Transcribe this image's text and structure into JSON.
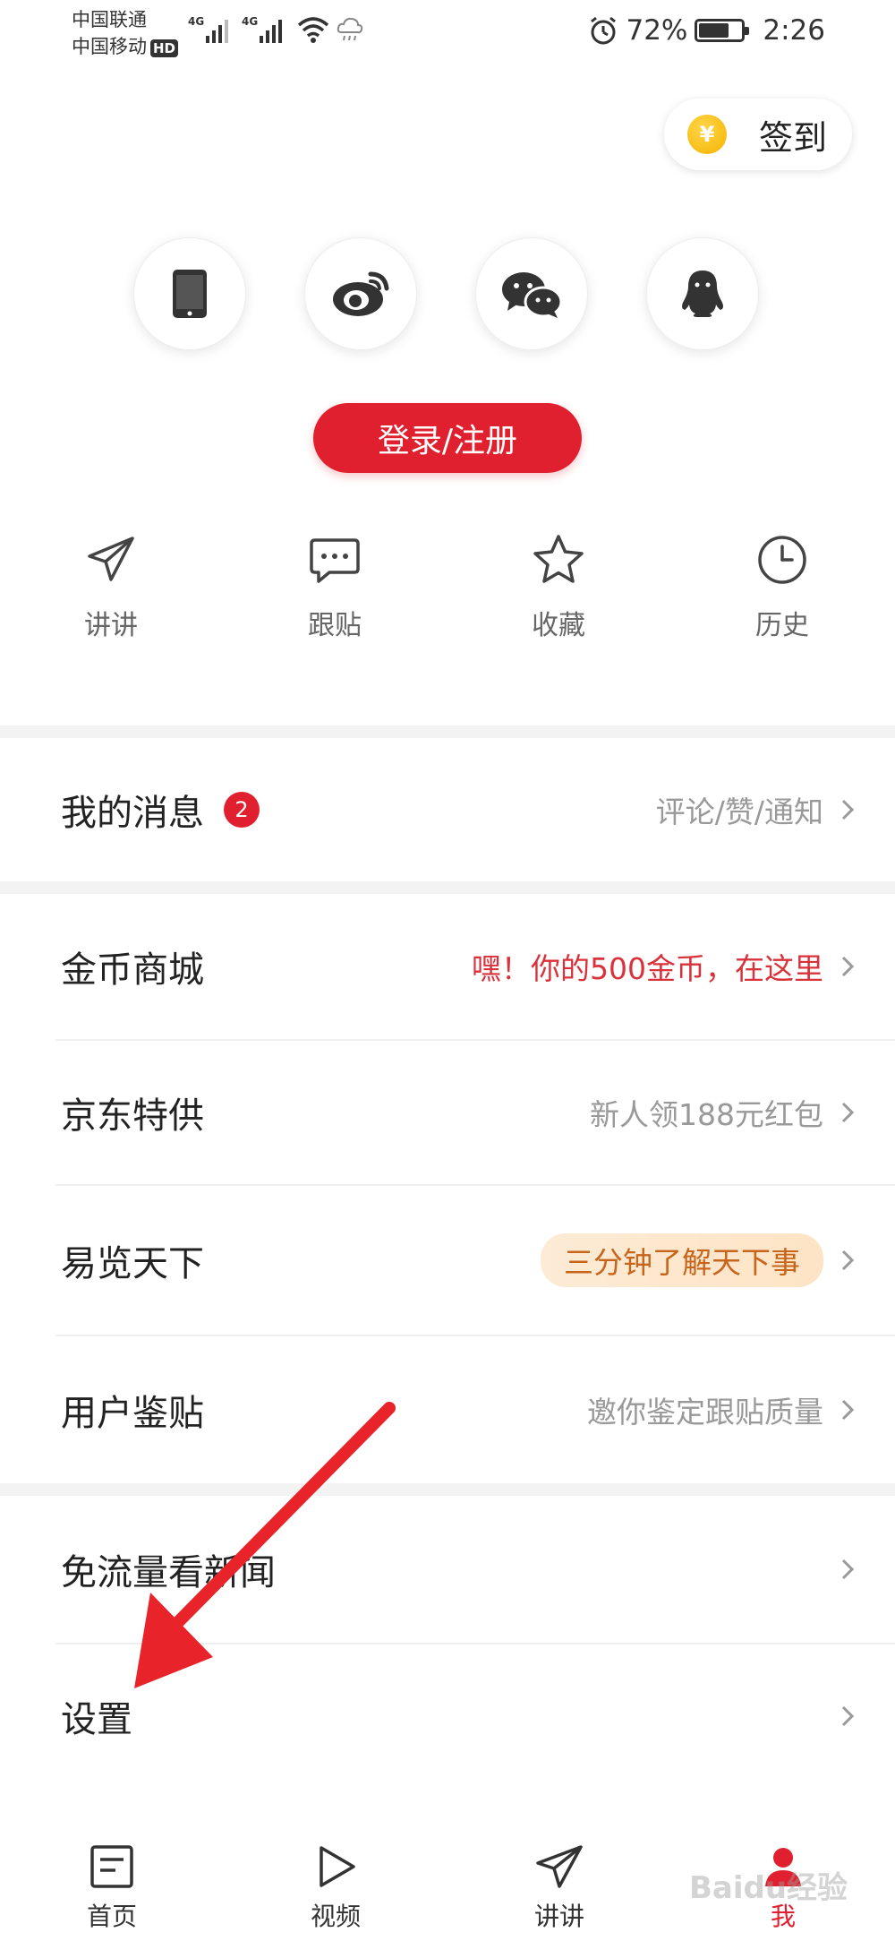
{
  "status_bar": {
    "carrier1": "中国联通",
    "carrier2": "中国移动",
    "hd_badge": "HD",
    "network1": "4G",
    "network2": "4G",
    "battery_percent": "72%",
    "battery_level": 0.72,
    "time": "2:26"
  },
  "signin": {
    "coin_symbol": "¥",
    "label": "签到"
  },
  "social_login": [
    "phone-icon",
    "weibo-icon",
    "wechat-icon",
    "qq-icon"
  ],
  "login_button": "登录/注册",
  "quick_actions": [
    {
      "label": "讲讲",
      "icon": "paper-plane-icon"
    },
    {
      "label": "跟贴",
      "icon": "comment-icon"
    },
    {
      "label": "收藏",
      "icon": "star-icon"
    },
    {
      "label": "历史",
      "icon": "clock-icon"
    }
  ],
  "messages": {
    "title": "我的消息",
    "badge": "2",
    "detail": "评论/赞/通知"
  },
  "menu": [
    {
      "title": "金币商城",
      "detail": "嘿！你的500金币，在这里"
    },
    {
      "title": "京东特供",
      "detail": "新人领188元红包"
    },
    {
      "title": "易览天下",
      "detail": "三分钟了解天下事"
    },
    {
      "title": "用户鉴贴",
      "detail": "邀你鉴定跟贴质量"
    }
  ],
  "menu2": [
    {
      "title": "免流量看新闻",
      "detail": ""
    },
    {
      "title": "设置",
      "detail": ""
    }
  ],
  "bottom_nav": [
    {
      "label": "首页",
      "icon": "home-icon"
    },
    {
      "label": "视频",
      "icon": "play-icon"
    },
    {
      "label": "讲讲",
      "icon": "paper-plane-icon"
    },
    {
      "label": "我",
      "icon": "profile-icon",
      "active": true
    }
  ],
  "watermark": "Baidu经验",
  "colors": {
    "accent": "#e0202e",
    "gold_text": "#d9323a",
    "orange_pill": "#c8651c"
  }
}
